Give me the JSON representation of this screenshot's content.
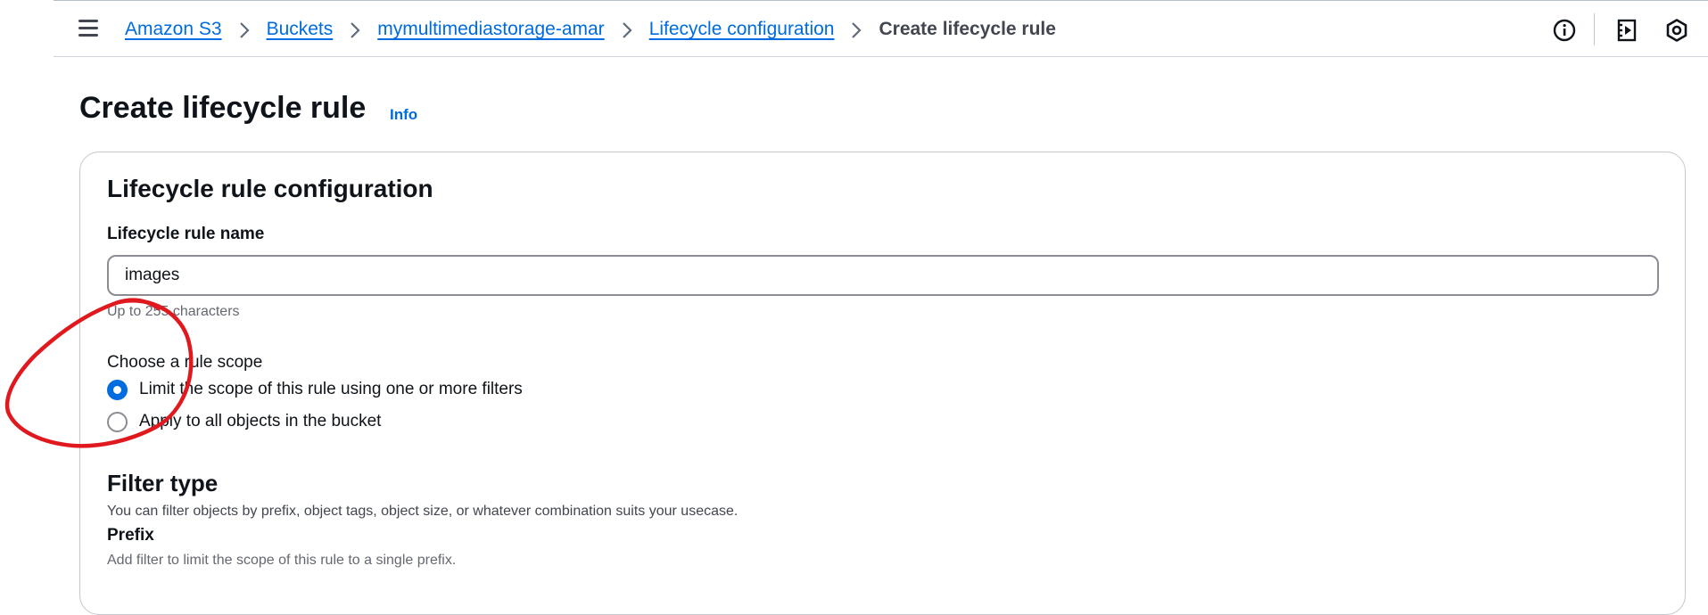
{
  "header": {
    "breadcrumbs": [
      {
        "label": "Amazon S3"
      },
      {
        "label": "Buckets"
      },
      {
        "label": "mymultimediastorage-amar"
      },
      {
        "label": "Lifecycle configuration"
      }
    ],
    "current": "Create lifecycle rule",
    "icons": [
      "menu-icon",
      "info-icon",
      "notifications-icon",
      "settings-icon"
    ]
  },
  "page": {
    "title": "Create lifecycle rule",
    "info_link": "Info"
  },
  "config": {
    "title": "Lifecycle rule configuration",
    "name_label": "Lifecycle rule name",
    "name_value": "images",
    "name_constraint": "Up to 255 characters",
    "scope_label": "Choose a rule scope",
    "scope_options": [
      {
        "label": "Limit the scope of this rule using one or more filters",
        "selected": true
      },
      {
        "label": "Apply to all objects in the bucket",
        "selected": false
      }
    ]
  },
  "filter": {
    "title": "Filter type",
    "description": "You can filter objects by prefix, object tags, object size, or whatever combination suits your usecase.",
    "prefix_label": "Prefix",
    "prefix_description": "Add filter to limit the scope of this rule to a single prefix."
  },
  "colors": {
    "link": "#006ce0",
    "annotation": "#e0191f"
  }
}
